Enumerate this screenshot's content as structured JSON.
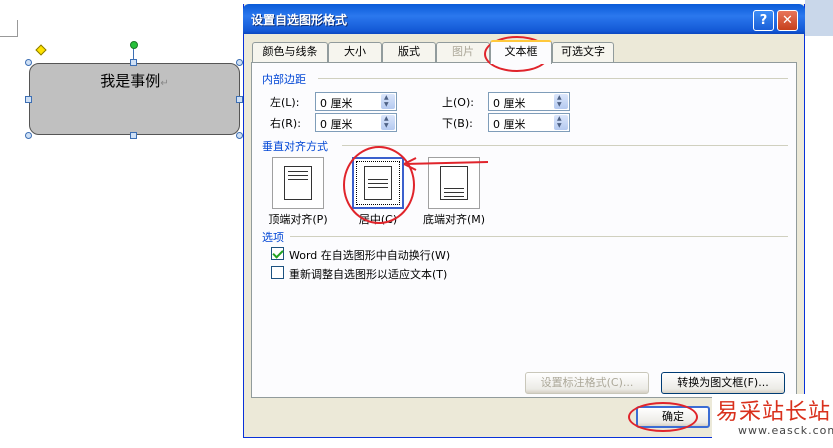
{
  "shape": {
    "text": "我是事例",
    "mark": "↵"
  },
  "dialog": {
    "title": "设置自选图形格式",
    "help": "?",
    "close": "✕",
    "tabs": [
      {
        "label": "颜色与线条",
        "state": "normal"
      },
      {
        "label": "大小",
        "state": "normal"
      },
      {
        "label": "版式",
        "state": "normal"
      },
      {
        "label": "图片",
        "state": "disabled"
      },
      {
        "label": "文本框",
        "state": "active"
      },
      {
        "label": "可选文字",
        "state": "normal"
      }
    ],
    "margins": {
      "title": "内部边距",
      "left_label": "左(L):",
      "left_value": "0 厘米",
      "right_label": "右(R):",
      "right_value": "0 厘米",
      "top_label": "上(O):",
      "top_value": "0 厘米",
      "bottom_label": "下(B):",
      "bottom_value": "0 厘米"
    },
    "valign": {
      "title": "垂直对齐方式",
      "top_label": "顶端对齐(P)",
      "center_label": "居中(C)",
      "bottom_label": "底端对齐(M)",
      "selected": "center"
    },
    "options": {
      "title": "选项",
      "wrap_label": "Word 在自选图形中自动换行(W)",
      "wrap_checked": true,
      "resize_label": "重新调整自选图形以适应文本(T)",
      "resize_checked": false
    },
    "buttons": {
      "callout_label": "设置标注格式(C)...",
      "convert_label": "转换为图文框(F)...",
      "ok_label": "确定"
    }
  },
  "watermark": {
    "cn": "易采站长站",
    "en": "www.easck.com"
  },
  "colors": {
    "title_blue": "#0a5bd8",
    "group_blue": "#0046d5",
    "annotation_red": "#e0242b",
    "watermark_red": "#d9301c"
  }
}
